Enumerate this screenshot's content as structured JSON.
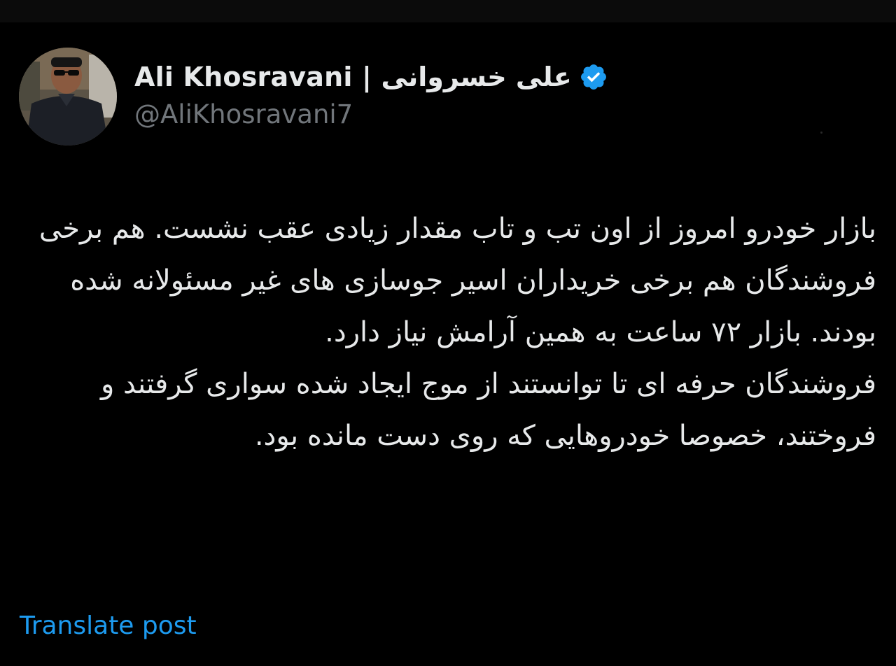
{
  "author": {
    "display_name": "Ali Khosravani | علی خسروانی",
    "handle": "@AliKhosravani7",
    "verified_icon": "verified-badge-icon",
    "avatar_icon": "profile-photo"
  },
  "post": {
    "paragraphs": [
      "بازار خودرو امروز از اون تب و تاب مقدار زیادی عقب نشست. هم برخی فروشندگان هم برخی خریداران اسیر جوسازی های غیر مسئولانه شده بودند. بازار ۷۲ ساعت به همین آرامش نیاز دارد.",
      "فروشندگان حرفه ای تا توانستند از موج ایجاد شده سواری گرفتند و فروختند، خصوصا خودروهایی که روی دست مانده بود."
    ]
  },
  "actions": {
    "translate_label": "Translate post"
  },
  "colors": {
    "background": "#000000",
    "text": "#e7e9ea",
    "muted": "#71767b",
    "link": "#1d9bf0",
    "verified": "#1d9bf0"
  }
}
